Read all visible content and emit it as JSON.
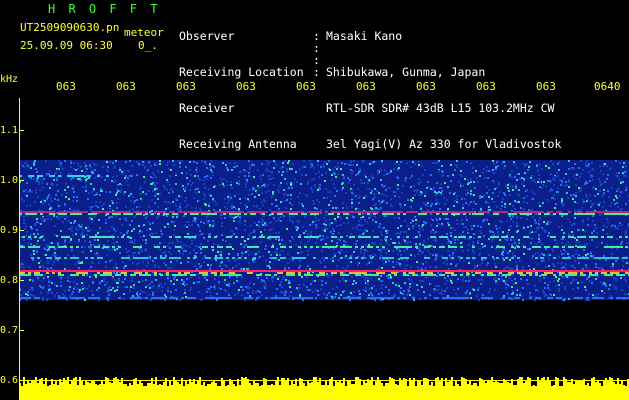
{
  "header": {
    "logo": "H R O F F T",
    "file_name": "UT2509090630.pn",
    "file_tag": "meteor",
    "datetime": "25.09.09 06:30",
    "datetime_extra": "0_."
  },
  "meta": {
    "labels": [
      "Observer",
      "Receiving Location",
      "Receiver",
      "Receiving Antenna"
    ],
    "values": [
      "Masaki Kano",
      "Shibukawa, Gunma, Japan",
      "RTL-SDR SDR# 43dB L15 103.2MHz CW",
      "3el Yagi(V) Az 330 for Vladivostok"
    ]
  },
  "axis": {
    "y_unit": "kHz",
    "y_ticks": [
      "1.1",
      "1.0",
      "0.9",
      "0.8",
      "0.7",
      "0.6"
    ],
    "x_ticks": [
      "063",
      "063",
      "063",
      "063",
      "063",
      "063",
      "063",
      "063",
      "063",
      "0640"
    ]
  },
  "colors": {
    "axis": "#ffff33",
    "logo": "#33ff33",
    "header_text": "#ffffff",
    "band_strong": "#ff2060",
    "band_medium": "#20e0a0",
    "noise": "#0a1f8a"
  }
}
